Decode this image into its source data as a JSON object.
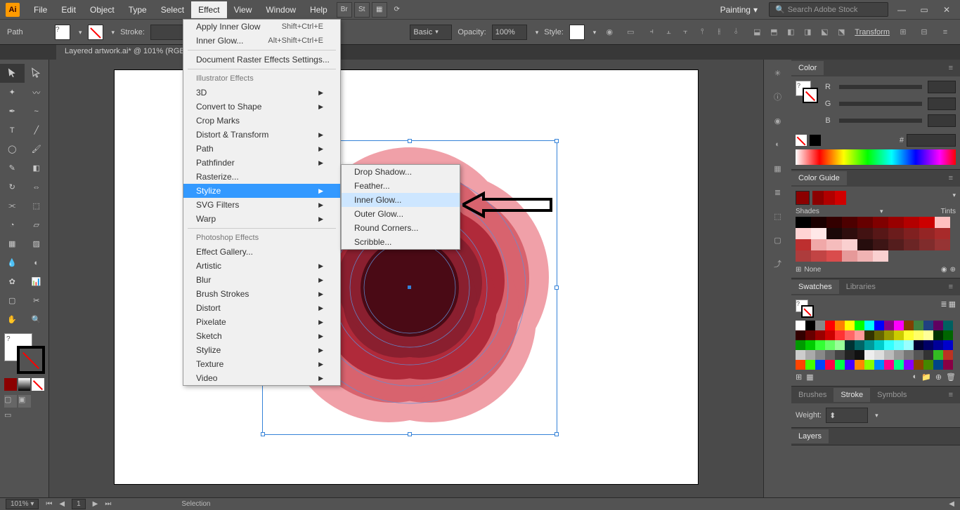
{
  "app": {
    "logo": "Ai"
  },
  "menubar": {
    "items": [
      "File",
      "Edit",
      "Object",
      "Type",
      "Select",
      "Effect",
      "View",
      "Window",
      "Help"
    ],
    "active_index": 5,
    "extras": [
      "Br",
      "St"
    ]
  },
  "workspace": {
    "label": "Painting"
  },
  "search": {
    "placeholder": "Search Adobe Stock"
  },
  "controlbar": {
    "selection_label": "Path",
    "stroke_label": "Stroke:",
    "basic_label": "Basic",
    "opacity_label": "Opacity:",
    "opacity_value": "100%",
    "style_label": "Style:",
    "transform_label": "Transform"
  },
  "document": {
    "tab": "Layered artwork.ai* @ 101% (RGB"
  },
  "effect_menu": {
    "apply": {
      "label": "Apply Inner Glow",
      "shortcut": "Shift+Ctrl+E"
    },
    "last": {
      "label": "Inner Glow...",
      "shortcut": "Alt+Shift+Ctrl+E"
    },
    "raster": "Document Raster Effects Settings...",
    "ill_header": "Illustrator Effects",
    "ill_items": [
      "3D",
      "Convert to Shape",
      "Crop Marks",
      "Distort & Transform",
      "Path",
      "Pathfinder",
      "Rasterize...",
      "Stylize",
      "SVG Filters",
      "Warp"
    ],
    "ill_arrows": [
      true,
      true,
      false,
      true,
      true,
      true,
      false,
      true,
      true,
      true
    ],
    "ps_header": "Photoshop Effects",
    "ps_items": [
      "Effect Gallery...",
      "Artistic",
      "Blur",
      "Brush Strokes",
      "Distort",
      "Pixelate",
      "Sketch",
      "Stylize",
      "Texture",
      "Video"
    ],
    "ps_arrows": [
      false,
      true,
      true,
      true,
      true,
      true,
      true,
      true,
      true,
      true
    ],
    "highlighted": 7
  },
  "stylize_submenu": {
    "items": [
      "Drop Shadow...",
      "Feather...",
      "Inner Glow...",
      "Outer Glow...",
      "Round Corners...",
      "Scribble..."
    ],
    "highlighted": 2
  },
  "panels": {
    "color": {
      "tab": "Color",
      "r": "R",
      "g": "G",
      "b": "B",
      "hash": "#"
    },
    "color_guide": {
      "tab": "Color Guide",
      "shades": "Shades",
      "tints": "Tints",
      "none": "None"
    },
    "swatches": {
      "tab": "Swatches",
      "lib_tab": "Libraries"
    },
    "brushes": {
      "b": "Brushes",
      "s": "Stroke",
      "sy": "Symbols",
      "weight": "Weight:"
    },
    "layers": {
      "tab": "Layers"
    }
  },
  "statusbar": {
    "zoom": "101%",
    "page": "1",
    "status": "Selection"
  },
  "big_fill_label": "?",
  "color_guide_swatches": [
    [
      "#000",
      "#1a0000",
      "#330000",
      "#4d0000",
      "#660000",
      "#800000",
      "#990000",
      "#b30000",
      "#cc0000",
      "#ffc0c0",
      "#ffd4d4",
      "#ffe8e8"
    ],
    [
      "#1a0808",
      "#2e0d0d",
      "#421212",
      "#571717",
      "#6b1c1c",
      "#802020",
      "#942525",
      "#a82a2a",
      "#bd2f2f",
      "#f0a8a8",
      "#f5bcbc",
      "#fad0d0"
    ],
    [
      "#260d0d",
      "#3d1515",
      "#541d1d",
      "#6b2525",
      "#802c2c",
      "#963434",
      "#ad3c3c",
      "#c24444",
      "#d94c4c",
      "#e69999",
      "#f0b3b3",
      "#fad0d0"
    ]
  ],
  "swatch_colors": [
    "#fff",
    "#000",
    "#888",
    "#f00",
    "#ff8000",
    "#ff0",
    "#0f0",
    "#0ff",
    "#00f",
    "#808",
    "#f0f",
    "#804000",
    "#408040",
    "#204080",
    "#600060",
    "#006060",
    "#300",
    "#600",
    "#900",
    "#c00",
    "#f33",
    "#f66",
    "#f99",
    "#330",
    "#660",
    "#990",
    "#cc0",
    "#ff3",
    "#ff6",
    "#ff9",
    "#030",
    "#060",
    "#090",
    "#0c0",
    "#3f3",
    "#6f6",
    "#9f9",
    "#033",
    "#066",
    "#099",
    "#0cc",
    "#3ff",
    "#6ff",
    "#9ff",
    "#003",
    "#006",
    "#009",
    "#00c",
    "#ccc",
    "#aaa",
    "#888",
    "#666",
    "#444",
    "#222",
    "#111",
    "#eee",
    "#ddd",
    "#bbb",
    "#999",
    "#777",
    "#555",
    "#333",
    "#3b2",
    "#b32",
    "#f40",
    "#4f0",
    "#04f",
    "#f04",
    "#0f4",
    "#40f",
    "#f80",
    "#8f0",
    "#08f",
    "#f08",
    "#0f8",
    "#80f",
    "#840",
    "#480",
    "#048",
    "#804"
  ]
}
